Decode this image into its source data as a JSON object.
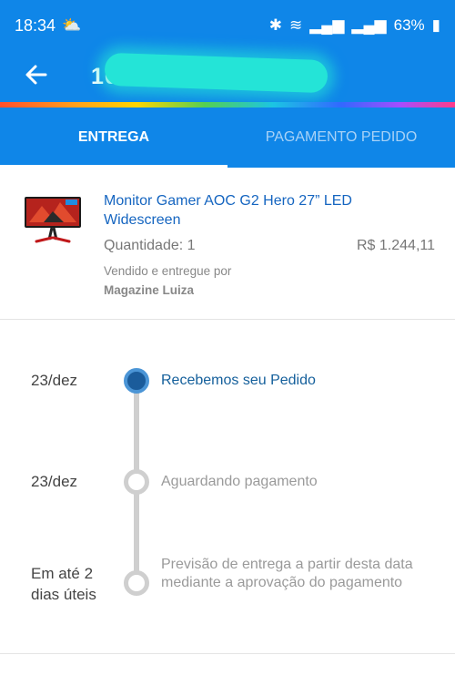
{
  "status_bar": {
    "time": "18:34",
    "weather_icon": "cloud-sun-icon",
    "battery": "63%",
    "icons": [
      "bluetooth-icon",
      "wifi-icon",
      "signal-icon",
      "signal-icon",
      "battery-icon"
    ]
  },
  "header": {
    "back_icon": "arrow-left-icon",
    "order_id": "10          940"
  },
  "tabs": [
    {
      "label": "ENTREGA",
      "active": true
    },
    {
      "label": "PAGAMENTO PEDIDO",
      "active": false
    }
  ],
  "product": {
    "name": "Monitor Gamer AOC G2 Hero 27” LED Widescreen",
    "quantity": "Quantidade: 1",
    "price": "R$ 1.244,11",
    "sold_by_label": "Vendido e entregue por",
    "seller": "Magazine Luiza"
  },
  "timeline": [
    {
      "date": "23/dez",
      "text": "Recebemos seu Pedido",
      "status": "done"
    },
    {
      "date": "23/dez",
      "text": "Aguardando pagamento",
      "status": "pending"
    },
    {
      "date": "Em até 2 dias úteis",
      "text": "Previsão de entrega a partir desta data mediante a aprovação do pagamento",
      "status": "pending"
    }
  ],
  "colors": {
    "primary": "#0f86e8",
    "link": "#1565c0",
    "active_dot": "#1b5c9b",
    "inactive": "#cfcfcf"
  }
}
